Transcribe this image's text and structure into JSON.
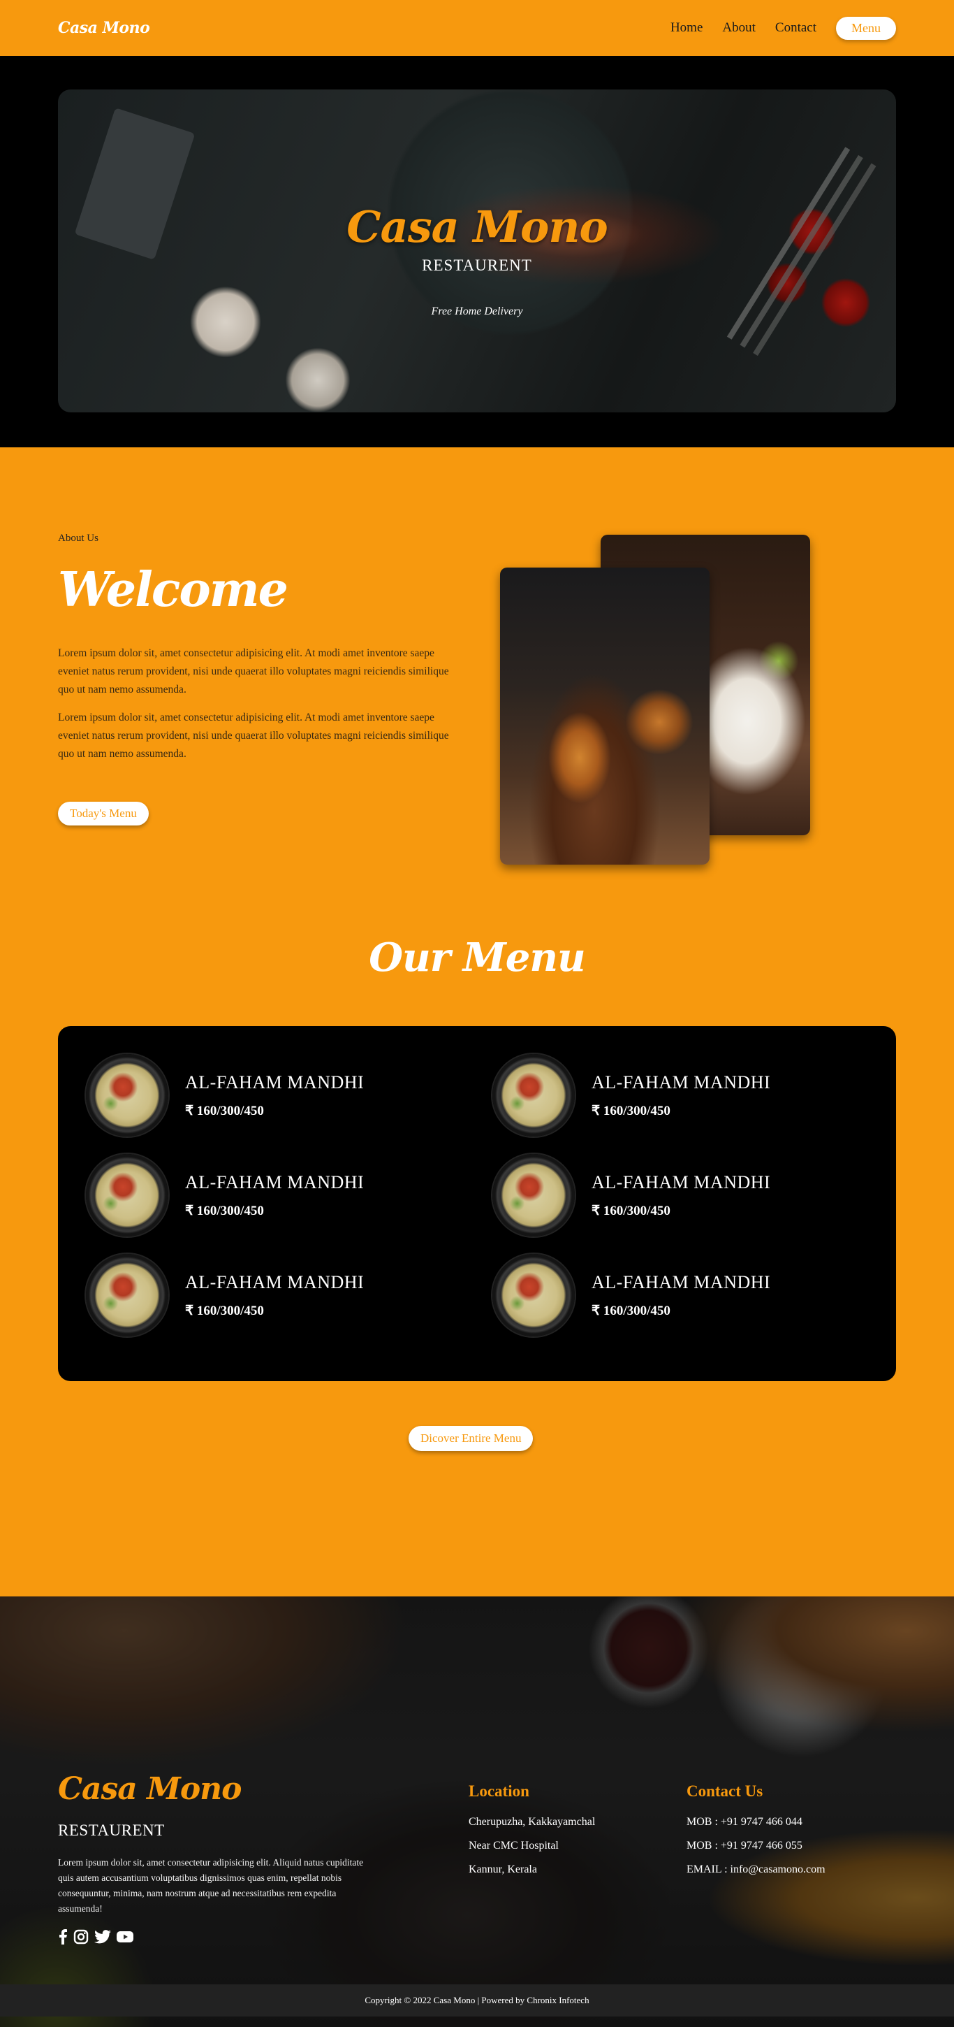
{
  "nav": {
    "brand": "Casa Mono",
    "links": [
      "Home",
      "About",
      "Contact"
    ],
    "menu_button": "Menu"
  },
  "hero": {
    "title": "Casa Mono",
    "subtitle": "RESTAURENT",
    "tagline": "Free Home Delivery"
  },
  "about": {
    "eyebrow": "About Us",
    "title": "Welcome",
    "paragraphs": [
      "Lorem ipsum dolor sit, amet consectetur adipisicing elit. At modi amet inventore saepe eveniet natus rerum provident, nisi unde quaerat illo voluptates magni reiciendis similique quo ut nam nemo assumenda.",
      "Lorem ipsum dolor sit, amet consectetur adipisicing elit. At modi amet inventore saepe eveniet natus rerum provident, nisi unde quaerat illo voluptates magni reiciendis similique quo ut nam nemo assumenda."
    ],
    "button": "Today's Menu"
  },
  "menu": {
    "title": "Our Menu",
    "items": [
      {
        "name": "AL-FAHAM MANDHI",
        "price": "₹ 160/300/450"
      },
      {
        "name": "AL-FAHAM MANDHI",
        "price": "₹ 160/300/450"
      },
      {
        "name": "AL-FAHAM MANDHI",
        "price": "₹ 160/300/450"
      },
      {
        "name": "AL-FAHAM MANDHI",
        "price": "₹ 160/300/450"
      },
      {
        "name": "AL-FAHAM MANDHI",
        "price": "₹ 160/300/450"
      },
      {
        "name": "AL-FAHAM MANDHI",
        "price": "₹ 160/300/450"
      }
    ],
    "button": "Dicover Entire Menu"
  },
  "footer": {
    "brand": "Casa Mono",
    "subtitle": "RESTAURENT",
    "description": "Lorem ipsum dolor sit, amet consectetur adipisicing elit. Aliquid natus cupiditate quis autem accusantium voluptatibus dignissimos quas enim, repellat nobis consequuntur, minima, nam nostrum atque ad necessitatibus rem expedita assumenda!",
    "social_icons": [
      "facebook-icon",
      "instagram-icon",
      "twitter-icon",
      "youtube-icon"
    ],
    "location": {
      "heading": "Location",
      "lines": [
        "Cherupuzha, Kakkayamchal",
        "Near CMC Hospital",
        "Kannur, Kerala"
      ]
    },
    "contact": {
      "heading": "Contact Us",
      "lines": [
        "MOB : +91 9747 466 044",
        "MOB : +91 9747 466 055",
        "EMAIL : info@casamono.com"
      ]
    },
    "copyright": "Copyright © 2022 Casa Mono | Powered by Chronix Infotech"
  },
  "colors": {
    "accent": "#f7990e",
    "dark": "#000000",
    "footer_bar": "#222222"
  }
}
